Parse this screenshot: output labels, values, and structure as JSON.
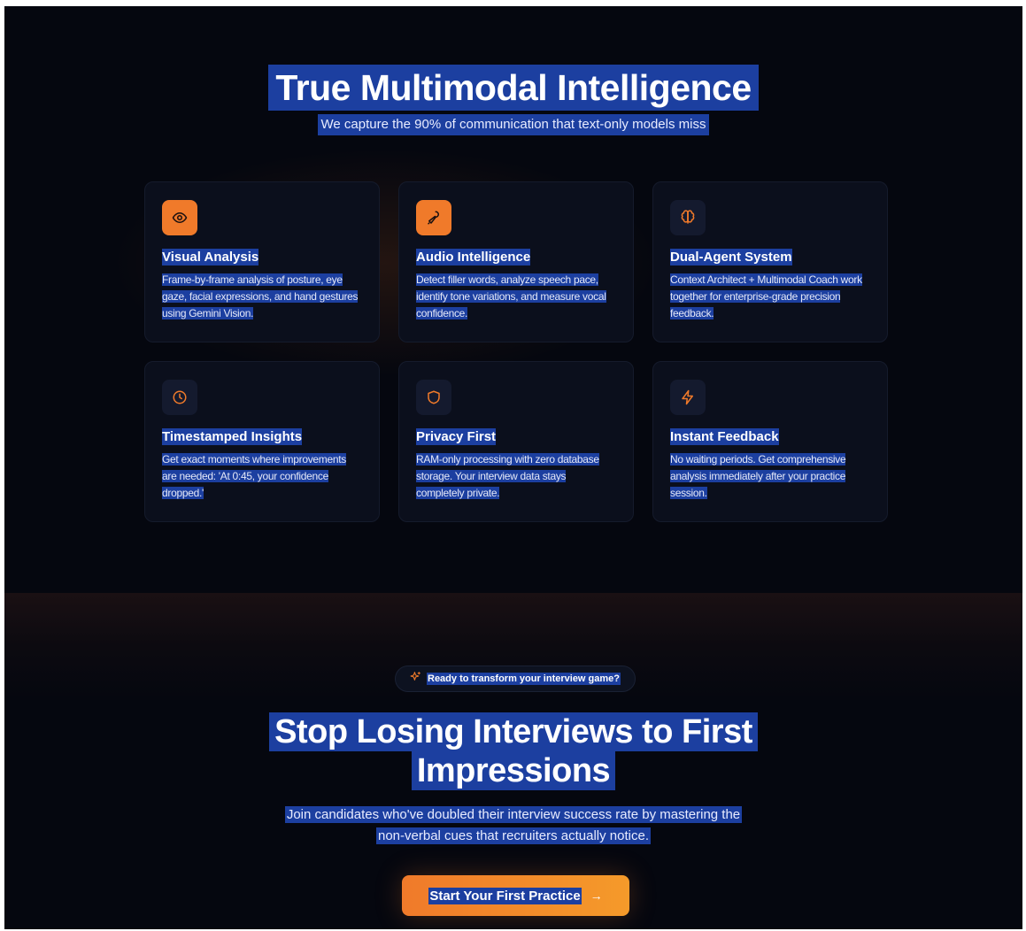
{
  "hero": {
    "title": "True Multimodal Intelligence",
    "subtitle": "We capture the 90% of communication that text-only models miss"
  },
  "features": [
    {
      "icon": "eye-icon",
      "title": "Visual Analysis",
      "description": "Frame-by-frame analysis of posture, eye gaze, facial expressions, and hand gestures using Gemini Vision."
    },
    {
      "icon": "microphone-icon",
      "title": "Audio Intelligence",
      "description": "Detect filler words, analyze speech pace, identify tone variations, and measure vocal confidence."
    },
    {
      "icon": "brain-icon",
      "title": "Dual-Agent System",
      "description": "Context Architect + Multimodal Coach work together for enterprise-grade precision feedback."
    },
    {
      "icon": "clock-icon",
      "title": "Timestamped Insights",
      "description": "Get exact moments where improvements are needed: 'At 0:45, your confidence dropped.'"
    },
    {
      "icon": "shield-icon",
      "title": "Privacy First",
      "description": "RAM-only processing with zero database storage. Your interview data stays completely private."
    },
    {
      "icon": "lightning-icon",
      "title": "Instant Feedback",
      "description": "No waiting periods. Get comprehensive analysis immediately after your practice session."
    }
  ],
  "cta_section": {
    "badge": "Ready to transform your interview game?",
    "title_line1": "Stop Losing Interviews to First",
    "title_line2": "Impressions",
    "description_line1": "Join candidates who've doubled their interview success rate by mastering the",
    "description_line2": "non-verbal cues that recruiters actually notice.",
    "button_label": "Start Your First Practice",
    "button_arrow": "→"
  },
  "colors": {
    "background": "#05070f",
    "card": "#0b0f1c",
    "accent": "#f07a2a",
    "selection": "#1c3fa0"
  }
}
